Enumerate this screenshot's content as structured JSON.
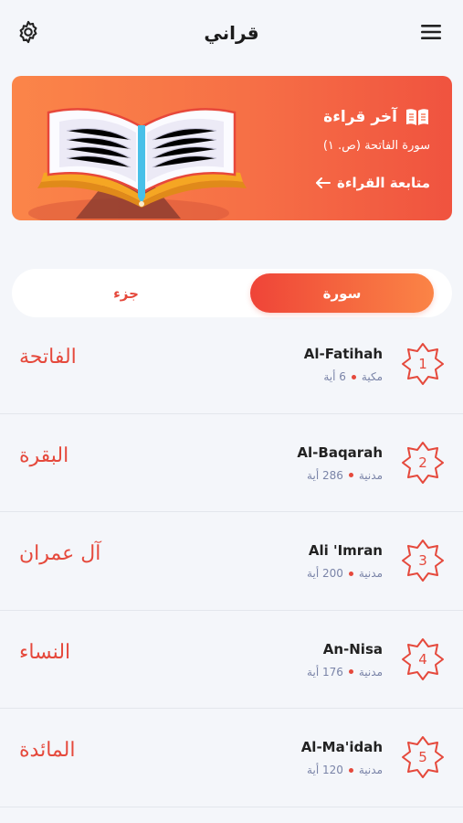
{
  "header": {
    "title": "قراني",
    "settings_icon": "gear-icon",
    "menu_icon": "hamburger-menu-icon"
  },
  "last_read": {
    "title": "آخر قراءة",
    "subtitle": "سورة الفاتحة (ص. ١)",
    "continue_label": "متابعة القراءة",
    "icon": "open-book-icon"
  },
  "tabs": {
    "juz_label": "جزء",
    "surah_label": "سورة",
    "active": "surah"
  },
  "surahs": [
    {
      "number": "1",
      "name": "Al-Fatihah",
      "arabic": "الفاتحة",
      "type": "مكية",
      "ayat": "6 أية"
    },
    {
      "number": "2",
      "name": "Al-Baqarah",
      "arabic": "البقرة",
      "type": "مدنية",
      "ayat": "286 أية"
    },
    {
      "number": "3",
      "name": "Ali 'Imran",
      "arabic": "آل عمران",
      "type": "مدنية",
      "ayat": "200 أية"
    },
    {
      "number": "4",
      "name": "An-Nisa",
      "arabic": "النساء",
      "type": "مدنية",
      "ayat": "176 أية"
    },
    {
      "number": "5",
      "name": "Al-Ma'idah",
      "arabic": "المائدة",
      "type": "مدنية",
      "ayat": "120 أية"
    }
  ],
  "colors": {
    "accent": "#e5493c",
    "banner_start": "#fb8549",
    "banner_end": "#f0533f",
    "meta_text": "#7a84a8"
  }
}
